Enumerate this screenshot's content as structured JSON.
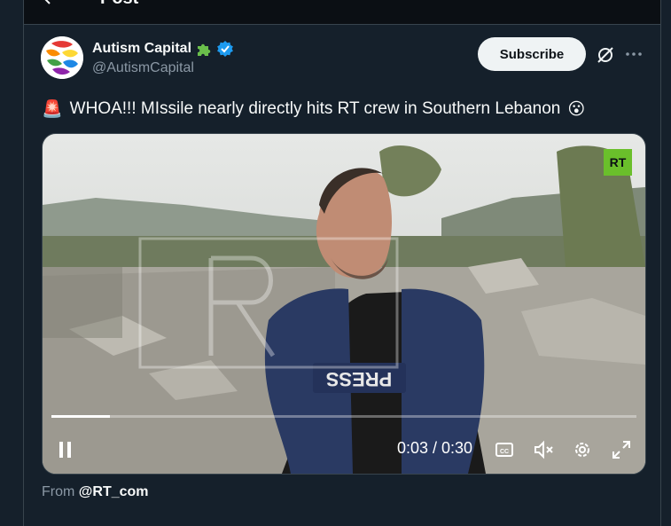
{
  "header": {
    "title": "Post"
  },
  "author": {
    "name": "Autism Capital",
    "handle": "@AutismCapital",
    "badge_emoji": "puzzle-piece-icon",
    "verified_color": "#1d9bf0"
  },
  "actions": {
    "subscribe_label": "Subscribe"
  },
  "tweet": {
    "alarm_emoji": "🚨",
    "text": "WHOA!!! MIssile nearly directly hits RT crew in Southern Lebanon",
    "end_emoji": "😮"
  },
  "video": {
    "logo": "RT",
    "vest_text": "PRESS",
    "time": "0:03 / 0:30",
    "progress": 0.1,
    "muted": true
  },
  "source": {
    "prefix": "From ",
    "account": "@RT_com"
  },
  "colors": {
    "background": "#15202b",
    "accent": "#1d9bf0",
    "rt_green": "#6abf2b"
  }
}
